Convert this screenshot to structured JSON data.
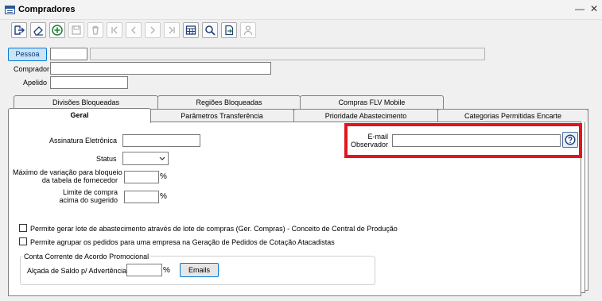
{
  "window": {
    "title": "Compradores",
    "minimize": "—",
    "close": "✕"
  },
  "form": {
    "pessoa_button": "Pessoa",
    "comprador_label": "Comprador",
    "apelido_label": "Apelido"
  },
  "tabs_row1": [
    "Divisões Bloqueadas",
    "Regiões Bloqueadas",
    "Compras FLV Mobile"
  ],
  "tabs_row2": [
    "Geral",
    "Parâmetros Transferência",
    "Prioridade Abastecimento",
    "Categorias Permitidas Encarte"
  ],
  "geral": {
    "assinatura_label": "Assinatura Eletrônica",
    "status_label": "Status",
    "max_variacao_label_1": "Máximo de variação para bloqueio",
    "max_variacao_label_2": "da tabela de fornecedor",
    "limite_label_1": "Limite de compra",
    "limite_label_2": "acima do sugerido",
    "percent": "%",
    "email_label_1": "E-mail",
    "email_label_2": "Observador",
    "checkbox1": "Permite gerar lote de abastecimento através de lote de compras  (Ger. Compras) - Conceito de Central de Produção",
    "checkbox2": "Permite agrupar os pedidos para uma empresa na Geração de Pedidos de Cotação Atacadistas",
    "group_title": "Conta Corrente de Acordo Promocional",
    "alcada_label": "Alçada de Saldo p/ Advertência",
    "emails_button": "Emails"
  },
  "colors": {
    "highlight": "#e1161c",
    "accent": "#0078d7"
  }
}
